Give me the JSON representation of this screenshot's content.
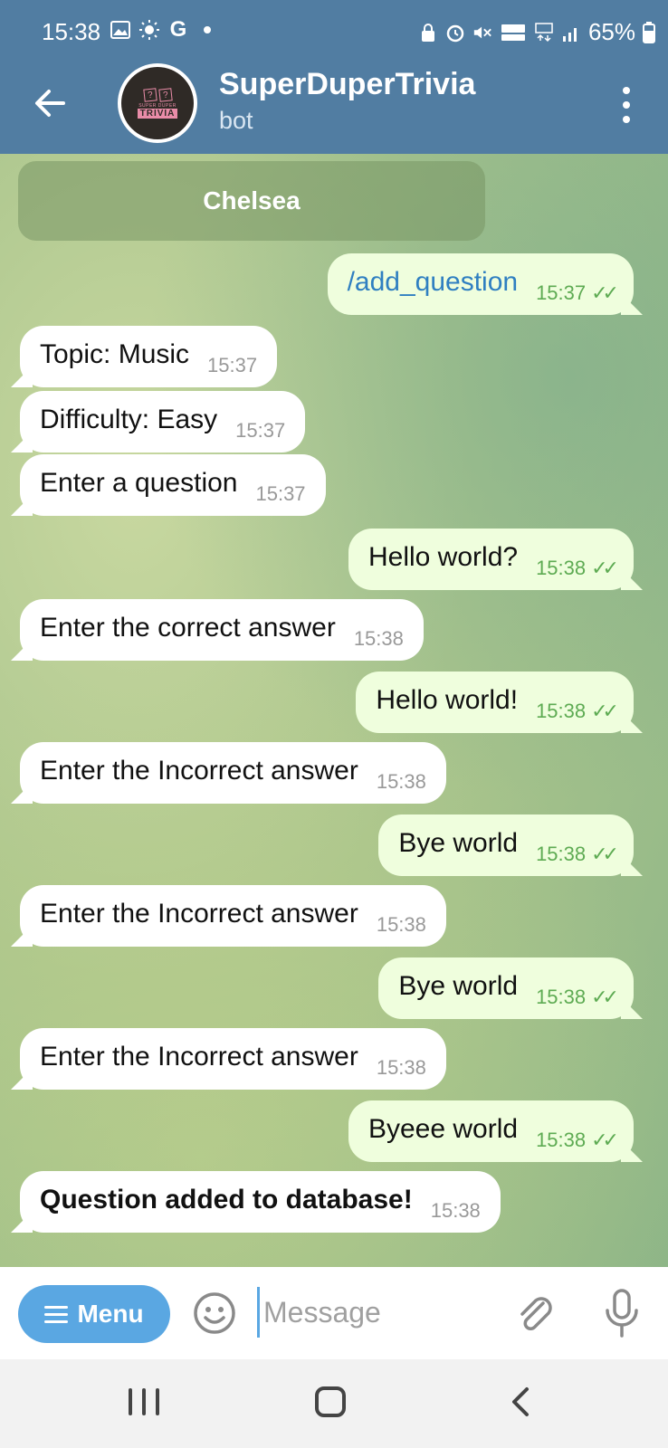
{
  "status_bar": {
    "time": "15:38",
    "left_icons": [
      "gallery-icon",
      "brightness-icon",
      "google-icon",
      "dot-icon"
    ],
    "google_letter": "G",
    "battery": "65%"
  },
  "header": {
    "title": "SuperDuperTrivia",
    "subtitle": "bot",
    "avatar": {
      "small_text": "SUPER DUPER",
      "big_text": "TRIVIA"
    }
  },
  "pinned": {
    "label": "Chelsea"
  },
  "messages": [
    {
      "side": "out",
      "text": "/add_question",
      "time": "15:37",
      "read": true
    },
    {
      "side": "in",
      "text": "Topic: Music",
      "time": "15:37"
    },
    {
      "side": "in",
      "text": "Difficulty: Easy",
      "time": "15:37"
    },
    {
      "side": "in",
      "text": "Enter a question",
      "time": "15:37"
    },
    {
      "side": "out",
      "text": "Hello world?",
      "time": "15:38",
      "read": true
    },
    {
      "side": "in",
      "text": "Enter the correct answer",
      "time": "15:38"
    },
    {
      "side": "out",
      "text": "Hello world!",
      "time": "15:38",
      "read": true
    },
    {
      "side": "in",
      "text": "Enter the Incorrect answer",
      "time": "15:38"
    },
    {
      "side": "out",
      "text": "Bye world",
      "time": "15:38",
      "read": true
    },
    {
      "side": "in",
      "text": "Enter the Incorrect answer",
      "time": "15:38"
    },
    {
      "side": "out",
      "text": "Bye world",
      "time": "15:38",
      "read": true
    },
    {
      "side": "in",
      "text": "Enter the Incorrect answer",
      "time": "15:38"
    },
    {
      "side": "out",
      "text": "Byeee world",
      "time": "15:38",
      "read": true
    },
    {
      "side": "in",
      "text": "Question added to database!",
      "time": "15:38",
      "bold": true
    }
  ],
  "input_bar": {
    "menu_label": "Menu",
    "placeholder": "Message"
  },
  "colors": {
    "header": "#517da2",
    "outgoing_bubble": "#effedd",
    "incoming_bubble": "#ffffff",
    "accent": "#5aa7e2",
    "read_tick": "#5eab53"
  }
}
